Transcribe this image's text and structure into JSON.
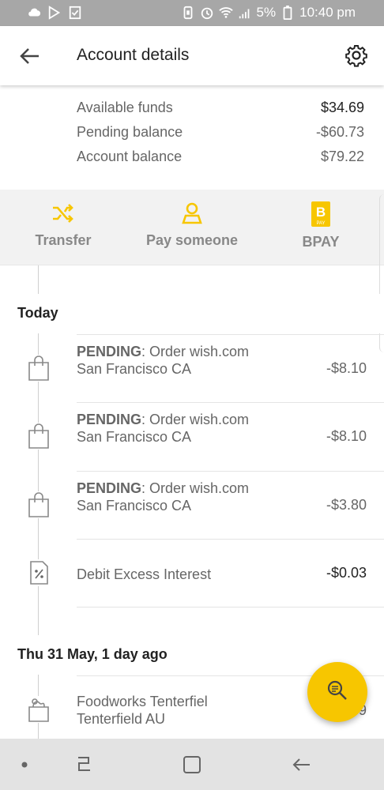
{
  "status_bar": {
    "battery": "5%",
    "time": "10:40 pm"
  },
  "header": {
    "title": "Account details"
  },
  "funds": [
    {
      "label": "Available funds",
      "value": "$34.69"
    },
    {
      "label": "Pending balance",
      "value": "-$60.73"
    },
    {
      "label": "Account balance",
      "value": "$79.22"
    }
  ],
  "actions": [
    {
      "label": "Transfer",
      "icon": "shuffle-icon"
    },
    {
      "label": "Pay someone",
      "icon": "person-icon"
    },
    {
      "label": "BPAY",
      "icon": "bpay-icon",
      "icon_text": "B",
      "icon_subtext": "PAY"
    }
  ],
  "sections": [
    {
      "title": "Today",
      "transactions": [
        {
          "pending": "PENDING",
          "desc": ": Order wish.com San Francisco CA",
          "amount": "-$8.10",
          "icon": "bag-icon"
        },
        {
          "pending": "PENDING",
          "desc": ": Order wish.com San Francisco CA",
          "amount": "-$8.10",
          "icon": "bag-icon"
        },
        {
          "pending": "PENDING",
          "desc": ": Order wish.com San Francisco CA",
          "amount": "-$3.80",
          "icon": "bag-icon"
        },
        {
          "pending": "",
          "desc": "Debit Excess Interest",
          "amount": "-$0.03",
          "icon": "percent-doc-icon"
        }
      ]
    },
    {
      "title": "Thu 31 May, 1 day ago",
      "transactions": [
        {
          "pending": "",
          "desc": "Foodworks Tenterfiel Tenterfield AU",
          "amount": "9",
          "icon": "grocery-icon"
        }
      ]
    }
  ],
  "colors": {
    "accent": "#f7c600",
    "status_bar": "#a7a7a7",
    "nav_bar": "#e3e3e3"
  }
}
